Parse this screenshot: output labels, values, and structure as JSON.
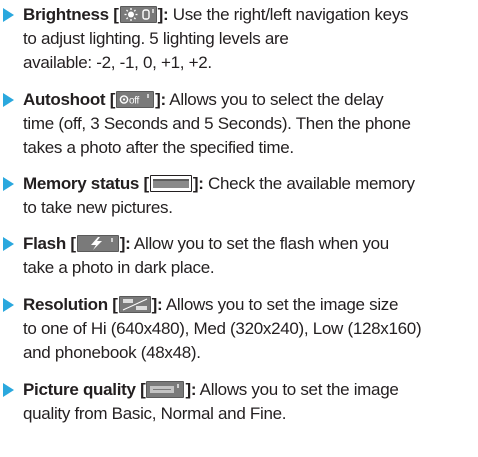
{
  "items": [
    {
      "title": "Brightness",
      "bracket_open": " [",
      "bracket_close": "]:",
      "icon": "sun-icon",
      "line1": " Use the right/left navigation keys",
      "line2": "to adjust lighting. 5 lighting levels are",
      "line3": "available: -2, -1, 0, +1, +2."
    },
    {
      "title": "Autoshoot",
      "bracket_open": " [",
      "bracket_close": "]:",
      "icon": "timer-off-icon",
      "line1": " Allows you to select the delay",
      "line2": "time (off, 3 Seconds and 5 Seconds). Then the phone",
      "line3": "takes a photo after the specified time."
    },
    {
      "title": "Memory status",
      "bracket_open": " [",
      "bracket_close": "]:",
      "icon": "memory-bar-icon",
      "line1": " Check the available memory",
      "line2": "to take new pictures."
    },
    {
      "title": "Flash",
      "bracket_open": " [",
      "bracket_close": "]:",
      "icon": "flash-icon",
      "line1": " Allow you to set the flash when you",
      "line2": "take a photo in dark place."
    },
    {
      "title": "Resolution",
      "bracket_open": " [",
      "bracket_close": "]:",
      "icon": "resolution-icon",
      "line1": " Allows you to set the image size",
      "line2": "to one of Hi (640x480), Med (320x240), Low (128x160)",
      "line3": "and phonebook (48x48)."
    },
    {
      "title": "Picture quality",
      "bracket_open": " [",
      "bracket_close": "]:",
      "icon": "quality-icon",
      "line1": " Allows you to set the image",
      "line2": "quality from Basic, Normal and Fine."
    }
  ],
  "colors": {
    "bullet": "#2aa8de",
    "text": "#231f20",
    "icon_bg": "#7a7a7a"
  }
}
